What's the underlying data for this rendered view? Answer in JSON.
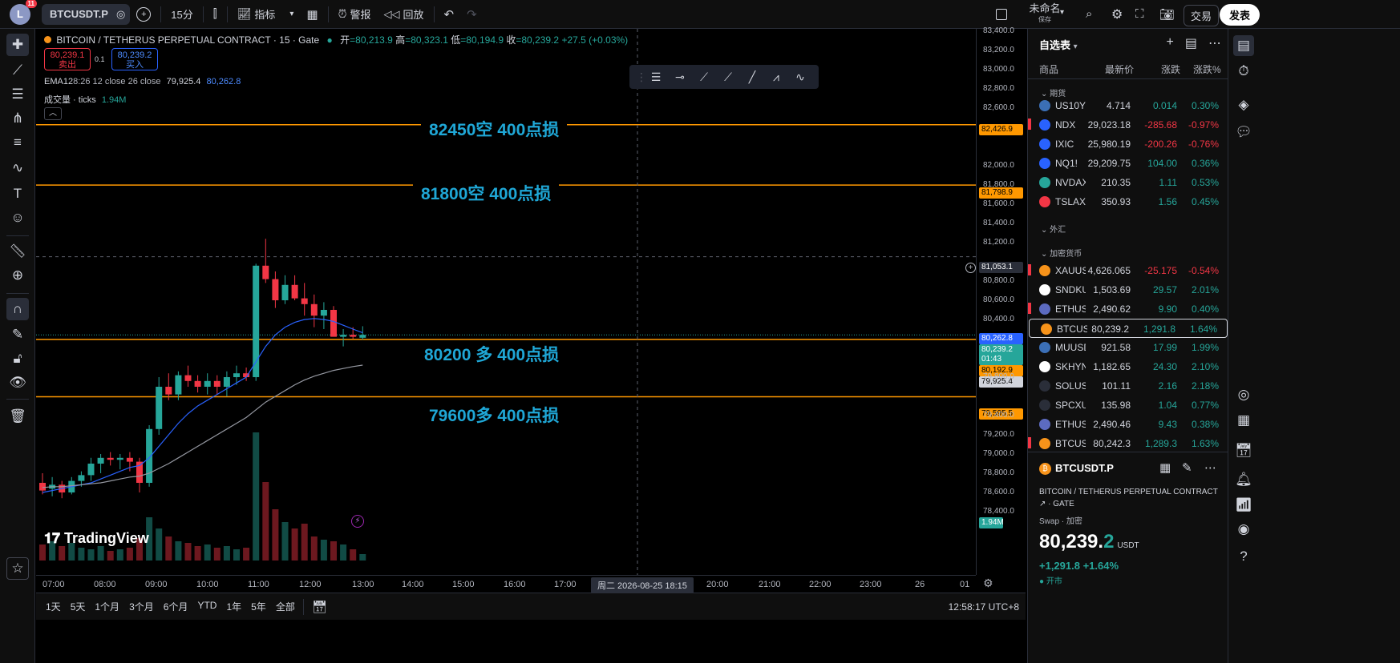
{
  "topbar": {
    "avatar_letter": "L",
    "notif_count": "11",
    "symbol": "BTCUSDT.P",
    "interval": "15分",
    "indicators": "指标",
    "alert": "警报",
    "replay": "回放",
    "layout_name": "未命名",
    "layout_saved": "保存",
    "trade": "交易",
    "publish": "发表"
  },
  "legend": {
    "title": "BITCOIN / TETHERUS PERPETUAL CONTRACT · 15 · Gate",
    "o_label": "开",
    "o": "=80,213.9",
    "h_label": "高",
    "h": "=80,323.1",
    "l_label": "低",
    "l": "=80,194.9",
    "c_label": "收",
    "c": "=80,239.2",
    "chg": "+27.5 (+0.03%)",
    "sell_price": "80,239.1",
    "sell_label": "卖出",
    "spread": "0.1",
    "buy_price": "80,239.2",
    "buy_label": "买入",
    "ema": "EMA12",
    "ema_rest": "8:26 12 close 26 close",
    "ema_v1": "79,925.4",
    "ema_v2": "80,262.8",
    "volume": "成交量 · ticks",
    "volume_v": "1.94M"
  },
  "annotations": [
    "82450空   400点损",
    "81800空  400点损",
    "80200 多    400点损",
    "79600多   400点损"
  ],
  "watermark": "TradingView",
  "price_axis": {
    "labels": [
      "83,400.0",
      "83,200.0",
      "83,000.0",
      "82,800.0",
      "82,600.0",
      "82,000.0",
      "81,800.0",
      "81,600.0",
      "81,400.0",
      "81,200.0",
      "80,800.0",
      "80,600.0",
      "80,400.0",
      "79,800.0",
      "79,400.0",
      "79,200.0",
      "79,000.0",
      "78,800.0",
      "78,600.0",
      "78,400.0"
    ],
    "tag_82426": "82,426.9",
    "tag_81798": "81,798.9",
    "tag_81053": "81,053.1",
    "tag_ema": "80,262.8",
    "tag_last": "80,239.2",
    "tag_count": "01:43",
    "tag_80192": "80,192.9",
    "tag_79925": "79,925.4",
    "tag_79595": "79,595.5",
    "tag_vol": "1.94M"
  },
  "time_axis": {
    "labels": [
      "07:00",
      "08:00",
      "09:00",
      "10:00",
      "11:00",
      "12:00",
      "13:00",
      "14:00",
      "15:00",
      "16:00",
      "17:00",
      "20:00",
      "21:00",
      "22:00",
      "23:00",
      "26",
      "01"
    ],
    "crosshair": "周二  2026-08-25    18:15"
  },
  "bottombar": {
    "ranges": [
      "1天",
      "5天",
      "1个月",
      "3个月",
      "6个月",
      "YTD",
      "1年",
      "5年",
      "全部"
    ],
    "clock": "12:58:17 UTC+8"
  },
  "watchlist": {
    "title": "自选表",
    "cols": [
      "商品",
      "最新价",
      "涨跌",
      "涨跌%"
    ],
    "sections": [
      "期货",
      "外汇",
      "加密货币"
    ],
    "rows": [
      {
        "sym": "US10Y",
        "px": "4.714",
        "ch": "0.014",
        "chp": "0.30%",
        "dir": "up"
      },
      {
        "sym": "NDX",
        "px": "29,023.18",
        "ch": "-285.68",
        "chp": "-0.97%",
        "dir": "dn"
      },
      {
        "sym": "IXIC",
        "px": "25,980.19",
        "ch": "-200.26",
        "chp": "-0.76%",
        "dir": "dn"
      },
      {
        "sym": "NQ1!",
        "px": "29,209.75",
        "ch": "104.00",
        "chp": "0.36%",
        "dir": "up"
      },
      {
        "sym": "NVDAXUSD",
        "px": "210.35",
        "ch": "1.11",
        "chp": "0.53%",
        "dir": "up"
      },
      {
        "sym": "TSLAXUSD",
        "px": "350.93",
        "ch": "1.56",
        "chp": "0.45%",
        "dir": "up"
      },
      {
        "sym": "XAUUSD",
        "px": "4,626.065",
        "ch": "-25.175",
        "chp": "-0.54%",
        "dir": "dn"
      },
      {
        "sym": "SNDKUSD",
        "px": "1,503.69",
        "ch": "29.57",
        "chp": "2.01%",
        "dir": "up"
      },
      {
        "sym": "ETHUSDT",
        "px": "2,490.62",
        "ch": "9.90",
        "chp": "0.40%",
        "dir": "up"
      },
      {
        "sym": "BTCUSDT",
        "px": "80,239.2",
        "ch": "1,291.8",
        "chp": "1.64%",
        "dir": "up"
      },
      {
        "sym": "MUUSDT",
        "px": "921.58",
        "ch": "17.99",
        "chp": "1.99%",
        "dir": "up"
      },
      {
        "sym": "SKHYNIX",
        "px": "1,182.65",
        "ch": "24.30",
        "chp": "2.10%",
        "dir": "up"
      },
      {
        "sym": "SOLUSDT",
        "px": "101.11",
        "ch": "2.16",
        "chp": "2.18%",
        "dir": "up"
      },
      {
        "sym": "SPCXUSD",
        "px": "135.98",
        "ch": "1.04",
        "chp": "0.77%",
        "dir": "up"
      },
      {
        "sym": "ETHUSDT",
        "px": "2,490.46",
        "ch": "9.43",
        "chp": "0.38%",
        "dir": "up"
      },
      {
        "sym": "BTCUSDT",
        "px": "80,242.3",
        "ch": "1,289.3",
        "chp": "1.63%",
        "dir": "up"
      }
    ]
  },
  "detail": {
    "symbol": "BTCUSDT.P",
    "name": "BITCOIN / TETHERUS PERPETUAL CONTRACT ↗ · GATE",
    "type": "Swap · 加密",
    "price_main": "80,239.",
    "price_last": "2",
    "unit": "USDT",
    "change": "+1,291.8  +1.64%",
    "status": "● 开市"
  },
  "colors": {
    "up": "#26a69a",
    "down": "#f23645",
    "hline": "#ff9800",
    "annot": "#1fa7d6",
    "ema12": "#2962ff",
    "ema26": "#9598a1"
  }
}
